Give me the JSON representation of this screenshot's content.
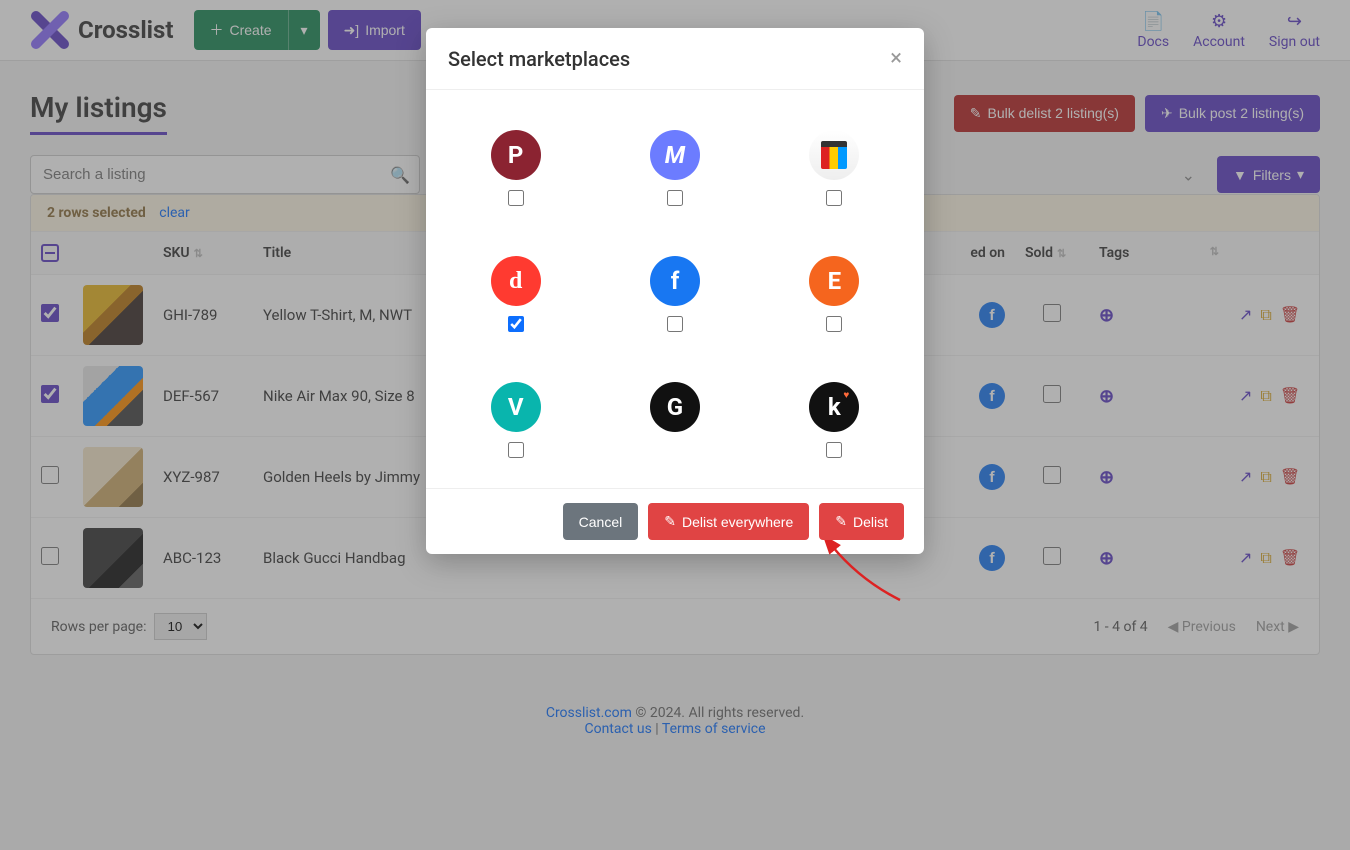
{
  "header": {
    "brand": "Crosslist",
    "create": "Create",
    "import": "Import",
    "nav": {
      "docs": "Docs",
      "account": "Account",
      "signout": "Sign out"
    }
  },
  "page": {
    "title": "My listings",
    "bulk_delist": "Bulk delist 2 listing(s)",
    "bulk_post": "Bulk post 2 listing(s)",
    "search_placeholder": "Search a listing",
    "filters": "Filters"
  },
  "selection": {
    "text": "2 rows selected",
    "clear": "clear"
  },
  "columns": {
    "sku": "SKU",
    "title": "Title",
    "listed_on": "ed on",
    "sold": "Sold",
    "tags": "Tags"
  },
  "rows": [
    {
      "selected": true,
      "sku": "GHI-789",
      "title": "Yellow T-Shirt, M, NWT",
      "thumb": "yellow"
    },
    {
      "selected": true,
      "sku": "DEF-567",
      "title": "Nike Air Max 90, Size 8",
      "thumb": "blue"
    },
    {
      "selected": false,
      "sku": "XYZ-987",
      "title": "Golden Heels by Jimmy",
      "thumb": "gold"
    },
    {
      "selected": false,
      "sku": "ABC-123",
      "title": "Black Gucci Handbag",
      "thumb": "black"
    }
  ],
  "pager": {
    "rows_label": "Rows per page:",
    "rows_value": "10",
    "range": "1 - 4 of 4",
    "prev": "Previous",
    "next": "Next"
  },
  "footer": {
    "site": "Crosslist.com",
    "copy": " © 2024. All rights reserved.",
    "contact": "Contact us",
    "sep": " | ",
    "tos": "Terms of service"
  },
  "modal": {
    "title": "Select marketplaces",
    "marketplaces": [
      {
        "id": "poshmark",
        "glyph": "P",
        "cls": "mp-poshmark",
        "checked": false
      },
      {
        "id": "mercari",
        "glyph": "M",
        "cls": "mp-mercari",
        "checked": false
      },
      {
        "id": "bonanza",
        "glyph": "",
        "cls": "mp-bonanza",
        "checked": false
      },
      {
        "id": "depop",
        "glyph": "d",
        "cls": "mp-depop",
        "checked": true
      },
      {
        "id": "facebook",
        "glyph": "f",
        "cls": "mp-facebook",
        "checked": false
      },
      {
        "id": "etsy",
        "glyph": "E",
        "cls": "mp-etsy",
        "checked": false
      },
      {
        "id": "vinted",
        "glyph": "V",
        "cls": "mp-vinted",
        "checked": false
      },
      {
        "id": "grailed",
        "glyph": "G",
        "cls": "mp-grailed",
        "checked": false
      },
      {
        "id": "kidizen",
        "glyph": "k",
        "cls": "mp-kids",
        "checked": false
      }
    ],
    "cancel": "Cancel",
    "delist_everywhere": "Delist everywhere",
    "delist": "Delist"
  }
}
